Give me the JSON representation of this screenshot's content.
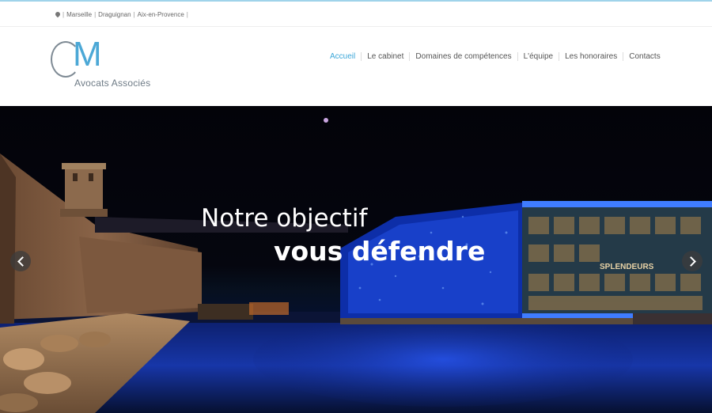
{
  "topbar": {
    "locations": [
      "Marseille",
      "Draguignan",
      "Aix-en-Provence"
    ]
  },
  "logo": {
    "letters": "CM",
    "subtitle": "Avocats Associés"
  },
  "nav": {
    "items": [
      "Accueil",
      "Le cabinet",
      "Domaines de compétences",
      "L'équipe",
      "Les honoraires",
      "Contacts"
    ],
    "active": "Accueil"
  },
  "hero": {
    "headline_line1": "Notre objectif",
    "headline_line2": "vous défendre",
    "building_sign": "SPLENDEURS"
  },
  "colors": {
    "accent": "#3aa6d8",
    "logo_blue": "#4ca8d6",
    "logo_grey": "#7e8a94"
  },
  "icons": {
    "location": "map-pin-icon",
    "prev": "chevron-left-icon",
    "next": "chevron-right-icon"
  }
}
